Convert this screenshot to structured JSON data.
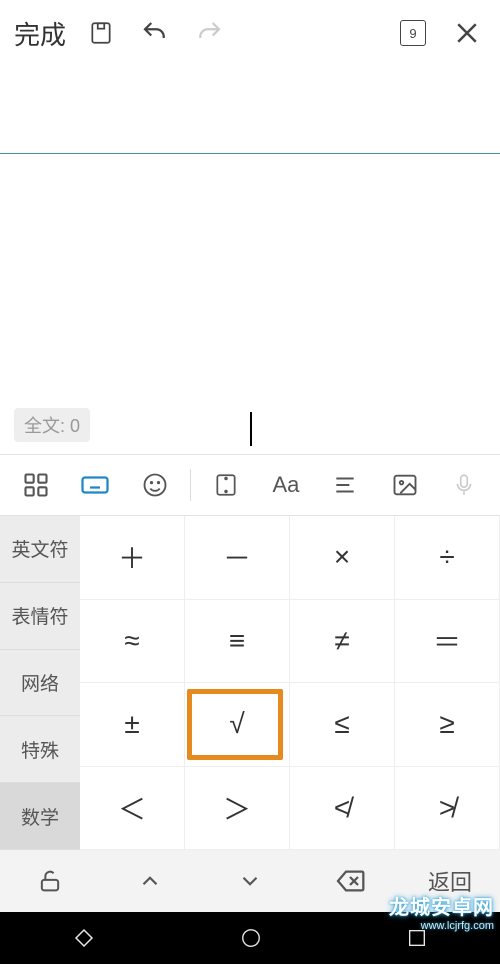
{
  "topbar": {
    "done": "完成",
    "page_indicator": "9"
  },
  "note": {
    "count_label": "全文: 0"
  },
  "categories": [
    "英文符",
    "表情符",
    "网络",
    "特殊",
    "数学"
  ],
  "selected_category_index": 4,
  "symbols": [
    [
      "＋",
      "－",
      "×",
      "÷"
    ],
    [
      "≈",
      "≡",
      "≠",
      "＝"
    ],
    [
      "±",
      "√",
      "≤",
      "≥"
    ],
    [
      "＜",
      "＞",
      "≮",
      "≯"
    ]
  ],
  "highlight": {
    "row": 2,
    "col": 1
  },
  "kb_back": "返回",
  "watermark": {
    "title": "龙城安卓网",
    "url": "www.lcjrfg.com"
  }
}
